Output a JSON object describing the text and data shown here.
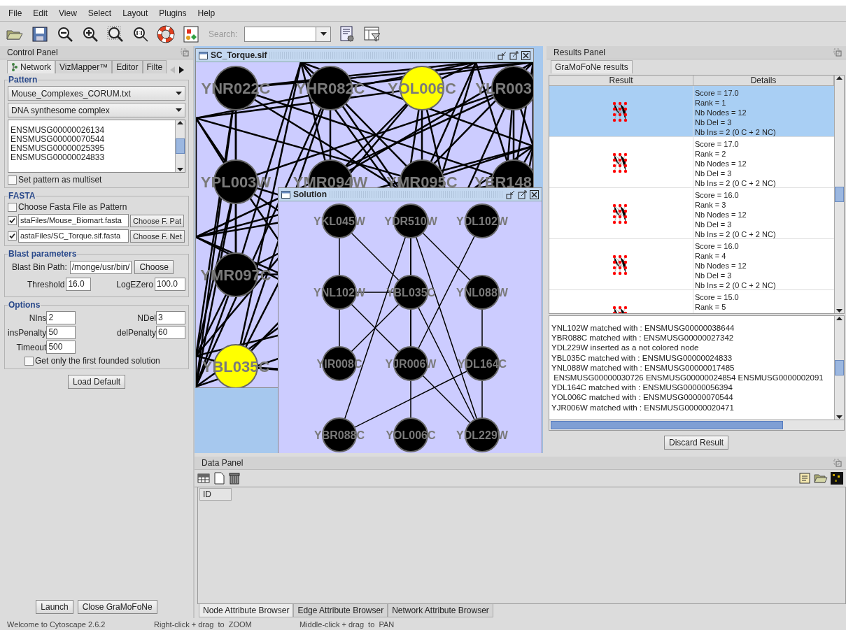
{
  "menu_bar": [
    "File",
    "Edit",
    "View",
    "Select",
    "Layout",
    "Plugins",
    "Help"
  ],
  "toolbar": {
    "search_label": "Search:"
  },
  "control_panel": {
    "title": "Control Panel",
    "tabs": [
      {
        "label": "Network",
        "selected": true
      },
      {
        "label": "VizMapper™",
        "selected": false
      },
      {
        "label": "Editor",
        "selected": false
      },
      {
        "label": "Filte",
        "selected": false
      }
    ],
    "pattern": {
      "title": "Pattern",
      "file_select": "Mouse_Complexes_CORUM.txt",
      "complex_select": "DNA synthesome complex",
      "genes": [
        "ENSMUSG00000026134",
        "ENSMUSG00000070544",
        "ENSMUSG00000025395",
        "ENSMUSG00000024833"
      ],
      "multiset": {
        "label": "Set pattern as multiset",
        "checked": false
      }
    },
    "fasta": {
      "title": "FASTA",
      "as_pattern": {
        "label": "Choose Fasta File as Pattern",
        "checked": false
      },
      "files": [
        {
          "checked": true,
          "path": "staFiles/Mouse_Biomart.fasta",
          "button": "Choose F. Pat"
        },
        {
          "checked": true,
          "path": "astaFiles/SC_Torque.sif.fasta",
          "button": "Choose F. Net"
        }
      ]
    },
    "blast": {
      "title": "Blast parameters",
      "bin_path_label": "Blast Bin Path:",
      "bin_path": "/monge/usr/bin/",
      "choose_button": "Choose",
      "threshold_label": "Threshold",
      "threshold": "16.0",
      "logezero_label": "LogEZero",
      "logezero": "100.0"
    },
    "options": {
      "title": "Options",
      "fields": [
        {
          "label": "NIns",
          "value": "2"
        },
        {
          "label": "NDel",
          "value": "3"
        },
        {
          "label": "insPenalty",
          "value": "50"
        },
        {
          "label": "delPenalty",
          "value": "60"
        },
        {
          "label": "Timeout",
          "value": "500"
        }
      ],
      "first_only": {
        "label": "Get only the first founded solution",
        "checked": false
      }
    },
    "load_default_button": "Load Default",
    "launch_button": "Launch",
    "close_button": "Close GraMoFoNe"
  },
  "network_window": {
    "title": "SC_Torque.sif",
    "nodes": [
      {
        "label": "YNR022C",
        "highlighted": false
      },
      {
        "label": "YHR082C",
        "highlighted": false
      },
      {
        "label": "YOL006C",
        "highlighted": true
      },
      {
        "label": "YLR003",
        "highlighted": false
      },
      {
        "label": "YPL003W",
        "highlighted": false
      },
      {
        "label": "YMR094W",
        "highlighted": false
      },
      {
        "label": "YMR095C",
        "highlighted": false
      },
      {
        "label": "YER148",
        "highlighted": false
      },
      {
        "label": "YMR097C",
        "highlighted": false
      },
      {
        "label": "YBL035C",
        "highlighted": true
      }
    ]
  },
  "solution_window": {
    "title": "Solution",
    "nodes": [
      {
        "label": "YKL045W",
        "highlighted": false
      },
      {
        "label": "YDR510W",
        "highlighted": false
      },
      {
        "label": "YDL102W",
        "highlighted": false
      },
      {
        "label": "YNL102W",
        "highlighted": false
      },
      {
        "label": "YBL035C",
        "highlighted": false
      },
      {
        "label": "YNL088W",
        "highlighted": false
      },
      {
        "label": "YIR008C",
        "highlighted": false
      },
      {
        "label": "YJR006W",
        "highlighted": false
      },
      {
        "label": "YDL164C",
        "highlighted": false
      },
      {
        "label": "YBR088C",
        "highlighted": false
      },
      {
        "label": "YOL006C",
        "highlighted": false
      },
      {
        "label": "YDL229W",
        "highlighted": false
      }
    ]
  },
  "results_panel": {
    "title": "Results Panel",
    "tabs": [
      {
        "label": "GraMoFoNe results",
        "selected": true
      }
    ],
    "columns": [
      "Result",
      "Details"
    ],
    "rows": [
      {
        "selected": true,
        "details": [
          "Score = 17.0",
          "Rank = 1",
          "Nb Nodes = 12",
          "Nb Del = 3",
          "Nb Ins = 2 (0 C + 2 NC)"
        ]
      },
      {
        "selected": false,
        "details": [
          "Score = 17.0",
          "Rank = 2",
          "Nb Nodes = 12",
          "Nb Del = 3",
          "Nb Ins = 2 (0 C + 2 NC)"
        ]
      },
      {
        "selected": false,
        "details": [
          "Score = 16.0",
          "Rank = 3",
          "Nb Nodes = 12",
          "Nb Del = 3",
          "Nb Ins = 2 (0 C + 2 NC)"
        ]
      },
      {
        "selected": false,
        "details": [
          "Score = 16.0",
          "Rank = 4",
          "Nb Nodes = 12",
          "Nb Del = 3",
          "Nb Ins = 2 (0 C + 2 NC)"
        ]
      },
      {
        "selected": false,
        "details": [
          "Score = 15.0",
          "Rank = 5"
        ]
      }
    ],
    "log": [
      "YNL102W matched with : ENSMUSG00000038644",
      "YBR088C matched with : ENSMUSG00000027342",
      "YDL229W inserted as a not colored node",
      "YBL035C matched with : ENSMUSG00000024833",
      "YNL088W matched with : ENSMUSG00000017485",
      " ENSMUSG00000030726 ENSMUSG00000024854 ENSMUSG0000002091",
      "YDL164C matched with : ENSMUSG00000056394",
      "YOL006C matched with : ENSMUSG00000070544",
      "YJR006W matched with : ENSMUSG00000020471"
    ],
    "discard_button": "Discard Result"
  },
  "data_panel": {
    "title": "Data Panel",
    "columns": [
      "ID"
    ],
    "tabs": [
      {
        "label": "Node Attribute Browser",
        "selected": true
      },
      {
        "label": "Edge Attribute Browser",
        "selected": false
      },
      {
        "label": "Network Attribute Browser",
        "selected": false
      }
    ]
  },
  "status_bar": [
    "Welcome to Cytoscape 2.6.2",
    "Right-click + drag  to  ZOOM",
    "Middle-click + drag  to  PAN"
  ]
}
